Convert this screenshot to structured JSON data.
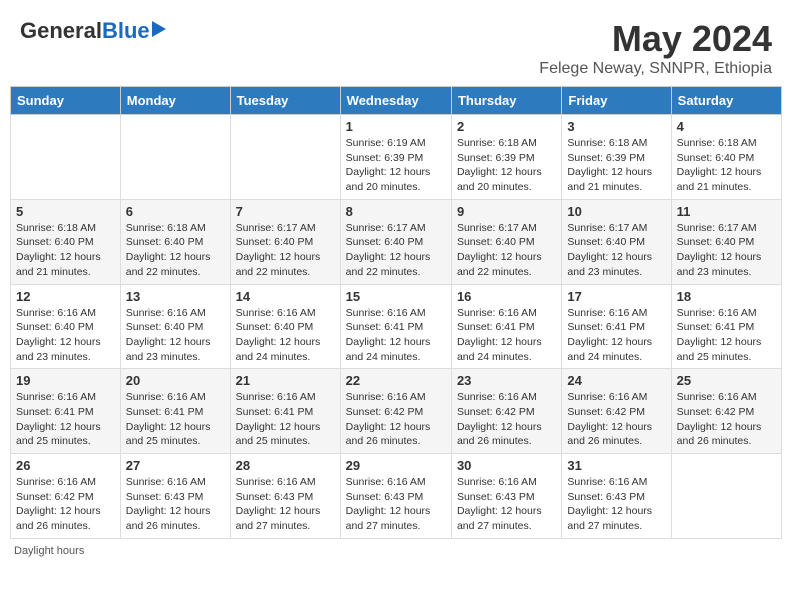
{
  "header": {
    "logo_general": "General",
    "logo_blue": "Blue",
    "title": "May 2024",
    "location": "Felege Neway, SNNPR, Ethiopia"
  },
  "days_of_week": [
    "Sunday",
    "Monday",
    "Tuesday",
    "Wednesday",
    "Thursday",
    "Friday",
    "Saturday"
  ],
  "weeks": [
    [
      {
        "day": "",
        "sunrise": "",
        "sunset": "",
        "daylight": ""
      },
      {
        "day": "",
        "sunrise": "",
        "sunset": "",
        "daylight": ""
      },
      {
        "day": "",
        "sunrise": "",
        "sunset": "",
        "daylight": ""
      },
      {
        "day": "1",
        "sunrise": "Sunrise: 6:19 AM",
        "sunset": "Sunset: 6:39 PM",
        "daylight": "Daylight: 12 hours and 20 minutes."
      },
      {
        "day": "2",
        "sunrise": "Sunrise: 6:18 AM",
        "sunset": "Sunset: 6:39 PM",
        "daylight": "Daylight: 12 hours and 20 minutes."
      },
      {
        "day": "3",
        "sunrise": "Sunrise: 6:18 AM",
        "sunset": "Sunset: 6:39 PM",
        "daylight": "Daylight: 12 hours and 21 minutes."
      },
      {
        "day": "4",
        "sunrise": "Sunrise: 6:18 AM",
        "sunset": "Sunset: 6:40 PM",
        "daylight": "Daylight: 12 hours and 21 minutes."
      }
    ],
    [
      {
        "day": "5",
        "sunrise": "Sunrise: 6:18 AM",
        "sunset": "Sunset: 6:40 PM",
        "daylight": "Daylight: 12 hours and 21 minutes."
      },
      {
        "day": "6",
        "sunrise": "Sunrise: 6:18 AM",
        "sunset": "Sunset: 6:40 PM",
        "daylight": "Daylight: 12 hours and 22 minutes."
      },
      {
        "day": "7",
        "sunrise": "Sunrise: 6:17 AM",
        "sunset": "Sunset: 6:40 PM",
        "daylight": "Daylight: 12 hours and 22 minutes."
      },
      {
        "day": "8",
        "sunrise": "Sunrise: 6:17 AM",
        "sunset": "Sunset: 6:40 PM",
        "daylight": "Daylight: 12 hours and 22 minutes."
      },
      {
        "day": "9",
        "sunrise": "Sunrise: 6:17 AM",
        "sunset": "Sunset: 6:40 PM",
        "daylight": "Daylight: 12 hours and 22 minutes."
      },
      {
        "day": "10",
        "sunrise": "Sunrise: 6:17 AM",
        "sunset": "Sunset: 6:40 PM",
        "daylight": "Daylight: 12 hours and 23 minutes."
      },
      {
        "day": "11",
        "sunrise": "Sunrise: 6:17 AM",
        "sunset": "Sunset: 6:40 PM",
        "daylight": "Daylight: 12 hours and 23 minutes."
      }
    ],
    [
      {
        "day": "12",
        "sunrise": "Sunrise: 6:16 AM",
        "sunset": "Sunset: 6:40 PM",
        "daylight": "Daylight: 12 hours and 23 minutes."
      },
      {
        "day": "13",
        "sunrise": "Sunrise: 6:16 AM",
        "sunset": "Sunset: 6:40 PM",
        "daylight": "Daylight: 12 hours and 23 minutes."
      },
      {
        "day": "14",
        "sunrise": "Sunrise: 6:16 AM",
        "sunset": "Sunset: 6:40 PM",
        "daylight": "Daylight: 12 hours and 24 minutes."
      },
      {
        "day": "15",
        "sunrise": "Sunrise: 6:16 AM",
        "sunset": "Sunset: 6:41 PM",
        "daylight": "Daylight: 12 hours and 24 minutes."
      },
      {
        "day": "16",
        "sunrise": "Sunrise: 6:16 AM",
        "sunset": "Sunset: 6:41 PM",
        "daylight": "Daylight: 12 hours and 24 minutes."
      },
      {
        "day": "17",
        "sunrise": "Sunrise: 6:16 AM",
        "sunset": "Sunset: 6:41 PM",
        "daylight": "Daylight: 12 hours and 24 minutes."
      },
      {
        "day": "18",
        "sunrise": "Sunrise: 6:16 AM",
        "sunset": "Sunset: 6:41 PM",
        "daylight": "Daylight: 12 hours and 25 minutes."
      }
    ],
    [
      {
        "day": "19",
        "sunrise": "Sunrise: 6:16 AM",
        "sunset": "Sunset: 6:41 PM",
        "daylight": "Daylight: 12 hours and 25 minutes."
      },
      {
        "day": "20",
        "sunrise": "Sunrise: 6:16 AM",
        "sunset": "Sunset: 6:41 PM",
        "daylight": "Daylight: 12 hours and 25 minutes."
      },
      {
        "day": "21",
        "sunrise": "Sunrise: 6:16 AM",
        "sunset": "Sunset: 6:41 PM",
        "daylight": "Daylight: 12 hours and 25 minutes."
      },
      {
        "day": "22",
        "sunrise": "Sunrise: 6:16 AM",
        "sunset": "Sunset: 6:42 PM",
        "daylight": "Daylight: 12 hours and 26 minutes."
      },
      {
        "day": "23",
        "sunrise": "Sunrise: 6:16 AM",
        "sunset": "Sunset: 6:42 PM",
        "daylight": "Daylight: 12 hours and 26 minutes."
      },
      {
        "day": "24",
        "sunrise": "Sunrise: 6:16 AM",
        "sunset": "Sunset: 6:42 PM",
        "daylight": "Daylight: 12 hours and 26 minutes."
      },
      {
        "day": "25",
        "sunrise": "Sunrise: 6:16 AM",
        "sunset": "Sunset: 6:42 PM",
        "daylight": "Daylight: 12 hours and 26 minutes."
      }
    ],
    [
      {
        "day": "26",
        "sunrise": "Sunrise: 6:16 AM",
        "sunset": "Sunset: 6:42 PM",
        "daylight": "Daylight: 12 hours and 26 minutes."
      },
      {
        "day": "27",
        "sunrise": "Sunrise: 6:16 AM",
        "sunset": "Sunset: 6:43 PM",
        "daylight": "Daylight: 12 hours and 26 minutes."
      },
      {
        "day": "28",
        "sunrise": "Sunrise: 6:16 AM",
        "sunset": "Sunset: 6:43 PM",
        "daylight": "Daylight: 12 hours and 27 minutes."
      },
      {
        "day": "29",
        "sunrise": "Sunrise: 6:16 AM",
        "sunset": "Sunset: 6:43 PM",
        "daylight": "Daylight: 12 hours and 27 minutes."
      },
      {
        "day": "30",
        "sunrise": "Sunrise: 6:16 AM",
        "sunset": "Sunset: 6:43 PM",
        "daylight": "Daylight: 12 hours and 27 minutes."
      },
      {
        "day": "31",
        "sunrise": "Sunrise: 6:16 AM",
        "sunset": "Sunset: 6:43 PM",
        "daylight": "Daylight: 12 hours and 27 minutes."
      },
      {
        "day": "",
        "sunrise": "",
        "sunset": "",
        "daylight": ""
      }
    ]
  ],
  "footer": {
    "daylight_hours_label": "Daylight hours"
  }
}
